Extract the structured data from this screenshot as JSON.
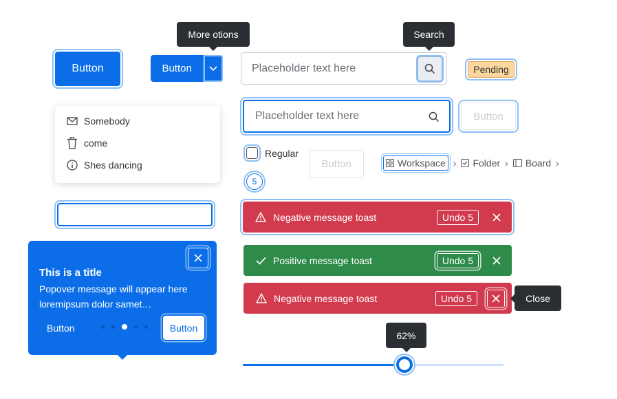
{
  "primary_button": {
    "label": "Button"
  },
  "split_button": {
    "label": "Button",
    "tooltip": "More otions"
  },
  "search_top": {
    "placeholder": "Placeholder text here",
    "tooltip": "Search"
  },
  "status_badge": {
    "label": "Pending"
  },
  "menu": {
    "items": [
      {
        "label": "Somebody",
        "icon": "mail-icon"
      },
      {
        "label": "come",
        "icon": "trash-icon"
      },
      {
        "label": "Shes dancing",
        "icon": "info-icon"
      }
    ]
  },
  "search_focused": {
    "placeholder": "Placeholder text here"
  },
  "disabled_button_top": {
    "label": "Button"
  },
  "checkbox": {
    "label": "Regular",
    "checked": false
  },
  "disabled_button_mid": {
    "label": "Button"
  },
  "count_badge": {
    "value": "5"
  },
  "breadcrumb": {
    "items": [
      {
        "label": "Workspace",
        "icon": "grid-icon"
      },
      {
        "label": "Folder",
        "icon": "checkbox-icon"
      },
      {
        "label": "Board",
        "icon": "board-icon"
      }
    ]
  },
  "toasts": [
    {
      "type": "negative",
      "message": "Negative message toast",
      "action": "Undo 5"
    },
    {
      "type": "positive",
      "message": "Positive message toast",
      "action": "Undo 5"
    },
    {
      "type": "negative",
      "message": "Negative message toast",
      "action": "Undo 5",
      "close_tooltip": "Close"
    }
  ],
  "popover": {
    "title": "This is a title",
    "message": "Popover message will appear here loremipsum dolor samet…",
    "ghost_button": "Button",
    "primary_button": "Button",
    "pages": 5,
    "active_page": 3
  },
  "slider": {
    "value": 62,
    "label": "62%"
  },
  "colors": {
    "primary": "#0b6ee8",
    "negative": "#d23a4d",
    "positive": "#2e8b4a",
    "warning": "#fbd69e",
    "tooltip": "#2b2e33"
  }
}
